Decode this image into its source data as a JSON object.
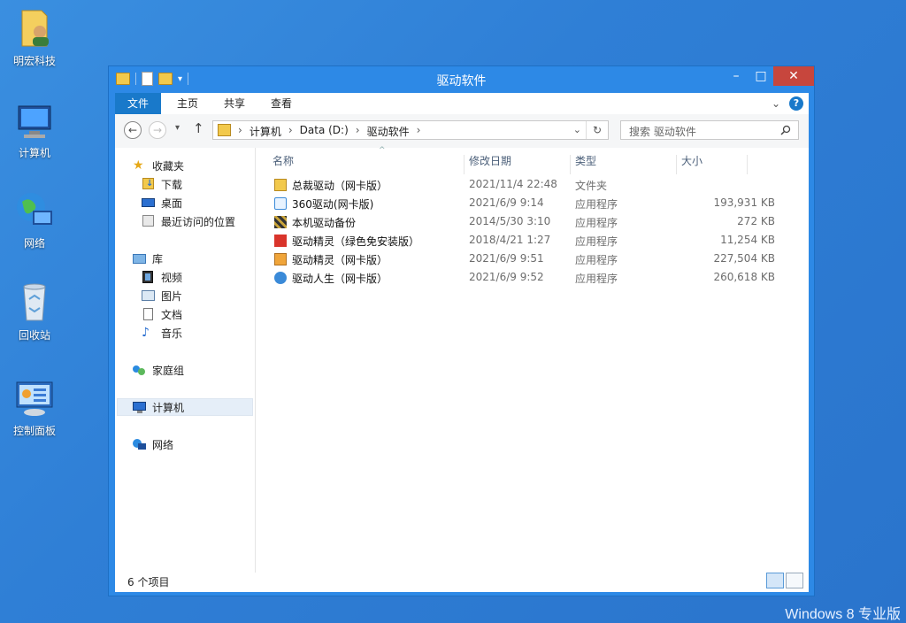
{
  "desktop": {
    "icons": [
      {
        "label": "明宏科技",
        "icon": "user-folder-icon"
      },
      {
        "label": "计算机",
        "icon": "computer-icon"
      },
      {
        "label": "网络",
        "icon": "network-icon"
      },
      {
        "label": "回收站",
        "icon": "recycle-bin-icon"
      },
      {
        "label": "控制面板",
        "icon": "control-panel-icon"
      }
    ],
    "watermark": "Windows 8 专业版"
  },
  "window": {
    "title": "驱动软件",
    "controls": {
      "minimize": "–",
      "maximize": "□",
      "close": "✕"
    },
    "ribbon": {
      "tabs": [
        "文件",
        "主页",
        "共享",
        "查看"
      ],
      "active_tab": "文件",
      "help": "?"
    },
    "address": {
      "crumbs": [
        "计算机",
        "Data (D:)",
        "驱动软件"
      ],
      "search_placeholder": "搜索 驱动软件"
    },
    "nav": {
      "favorites": {
        "label": "收藏夹",
        "items": [
          "下载",
          "桌面",
          "最近访问的位置"
        ]
      },
      "libraries": {
        "label": "库",
        "items": [
          "视频",
          "图片",
          "文档",
          "音乐"
        ]
      },
      "homegroup": "家庭组",
      "computer": "计算机",
      "network": "网络"
    },
    "columns": {
      "name": "名称",
      "date": "修改日期",
      "type": "类型",
      "size": "大小"
    },
    "files": [
      {
        "name": "总裁驱动（网卡版）",
        "date": "2021/11/4 22:48",
        "type": "文件夹",
        "size": "",
        "icon": "folder-icon"
      },
      {
        "name": "360驱动(网卡版)",
        "date": "2021/6/9 9:14",
        "type": "应用程序",
        "size": "193,931 KB",
        "icon": "360-app-icon"
      },
      {
        "name": "本机驱动备份",
        "date": "2014/5/30 3:10",
        "type": "应用程序",
        "size": "272 KB",
        "icon": "backup-app-icon"
      },
      {
        "name": "驱动精灵（绿色免安装版）",
        "date": "2018/4/21 1:27",
        "type": "应用程序",
        "size": "11,254 KB",
        "icon": "drivergenius-red-icon"
      },
      {
        "name": "驱动精灵（网卡版）",
        "date": "2021/6/9 9:51",
        "type": "应用程序",
        "size": "227,504 KB",
        "icon": "drivergenius-icon"
      },
      {
        "name": "驱动人生（网卡版）",
        "date": "2021/6/9 9:52",
        "type": "应用程序",
        "size": "260,618 KB",
        "icon": "drivelife-icon"
      }
    ],
    "status": "6 个项目"
  }
}
